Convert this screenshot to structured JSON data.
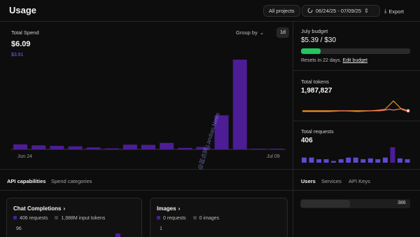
{
  "header": {
    "title": "Usage",
    "all_projects": "All projects",
    "date_range": "06/24/25 - 07/09/25",
    "export": "Export"
  },
  "spend": {
    "label": "Total Spend",
    "total": "$6.09",
    "max_label": "$3.61",
    "group_by": "Group by",
    "interval": "1d",
    "x_start": "Jun 24",
    "x_end": "Jul 09",
    "bar_color": "#4c1d95",
    "bars": [
      0.2,
      0.16,
      0.14,
      0.12,
      0.08,
      0.04,
      0.19,
      0.18,
      0.26,
      0.06,
      0.1,
      1.37,
      3.61,
      0.01,
      0.0
    ]
  },
  "budget": {
    "label": "July budget",
    "value": "$5.39 / $30",
    "fraction": 0.18,
    "reset_text": "Resets in 22 days.",
    "edit_link": "Edit budget"
  },
  "tokens": {
    "label": "Total tokens",
    "value": "1,987,827"
  },
  "requests": {
    "label": "Total requests",
    "value": "406",
    "bars": [
      6,
      6,
      4,
      4,
      2,
      4,
      6,
      6,
      4,
      5,
      4,
      6,
      18,
      5,
      4
    ]
  },
  "tabs": {
    "api_capabilities": "API capabilities",
    "spend_categories": "Spend categories"
  },
  "right_tabs": {
    "users": "Users",
    "services": "Services",
    "api_keys": "API Keys"
  },
  "chat_card": {
    "title": "Chat Completions",
    "requests": "406 requests",
    "tokens": "1,988M input tokens",
    "y_top": "96"
  },
  "images_card": {
    "title": "Images",
    "requests": "0 requests",
    "images": "0 images",
    "y_top": "1"
  },
  "user_row": {
    "count": "386"
  },
  "watermark": "@蓝点网 Landian.News",
  "colors": {
    "accent_purple": "#4c1d95",
    "budget_green": "#22c55e",
    "token_line_red": "#f87171",
    "token_line_orange": "#f59e0b"
  }
}
